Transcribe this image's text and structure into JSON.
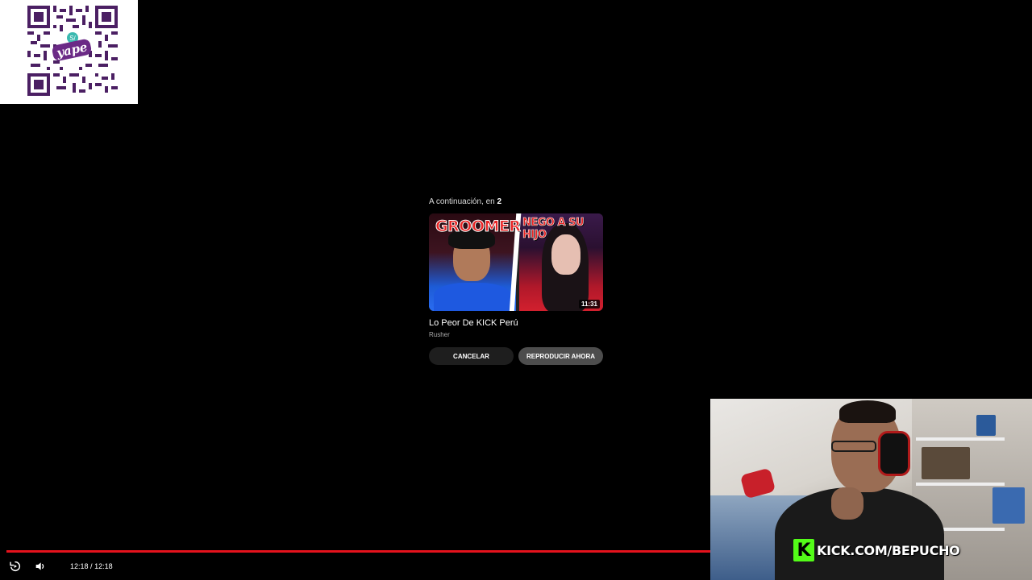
{
  "qr_overlay": {
    "logo_text": "yape",
    "logo_badge": "S/"
  },
  "up_next": {
    "heading_prefix": "A continuación, en",
    "countdown": "2",
    "thumbnail": {
      "text_left": "GROOMER",
      "text_right": "NEGO A SU HIJO",
      "duration": "11:31"
    },
    "title": "Lo Peor De KICK Perú",
    "channel": "Rusher",
    "cancel_label": "CANCELAR",
    "play_now_label": "REPRODUCIR AHORA"
  },
  "webcam": {
    "kick_logo_letter": "K",
    "kick_url": "KICK.COM/BEPUCHO"
  },
  "player": {
    "progress_fraction": 1.0,
    "current_time": "12:18",
    "separator": "/",
    "total_time": "12:18",
    "colors": {
      "progress": "#e5121c",
      "kick_green": "#53fc18",
      "yape_purple": "#6b2a86"
    },
    "icons": [
      "replay-icon",
      "volume-icon"
    ]
  }
}
